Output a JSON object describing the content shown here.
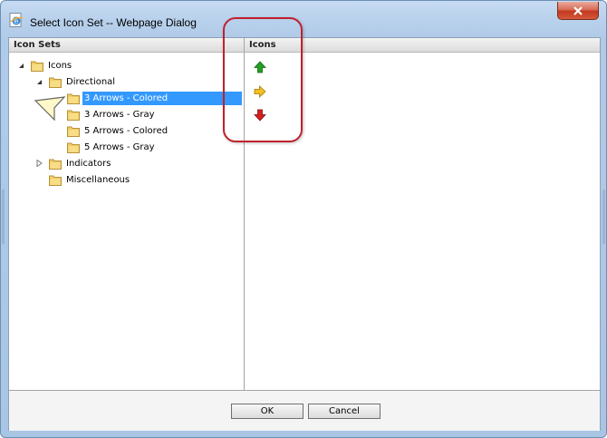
{
  "window": {
    "title": "Select Icon Set -- Webpage Dialog"
  },
  "left_pane": {
    "header": "Icon Sets",
    "tree": [
      {
        "label": "Icons",
        "expanded": true,
        "level": 0
      },
      {
        "label": "Directional",
        "expanded": true,
        "level": 1
      },
      {
        "label": "3 Arrows - Colored",
        "level": 2,
        "selected": true
      },
      {
        "label": "3 Arrows - Gray",
        "level": 2
      },
      {
        "label": "5 Arrows - Colored",
        "level": 2
      },
      {
        "label": "5 Arrows - Gray",
        "level": 2
      },
      {
        "label": "Indicators",
        "expanded": false,
        "level": 1
      },
      {
        "label": "Miscellaneous",
        "level": 1
      }
    ]
  },
  "right_pane": {
    "header": "Icons",
    "icons": [
      {
        "name": "green-up-arrow-icon",
        "color": "#22a022"
      },
      {
        "name": "yellow-right-arrow-icon",
        "color": "#f0c020"
      },
      {
        "name": "red-down-arrow-icon",
        "color": "#d42020"
      }
    ]
  },
  "footer": {
    "ok_label": "OK",
    "cancel_label": "Cancel"
  },
  "colors": {
    "selection": "#3399ff",
    "annotation": "#c0202c"
  }
}
